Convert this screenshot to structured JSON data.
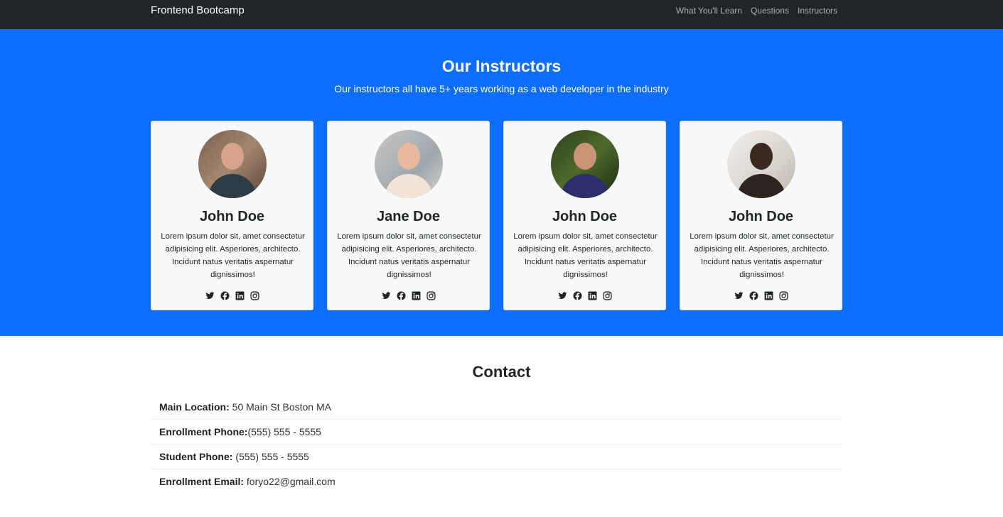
{
  "navbar": {
    "brand": "Frontend Bootcamp",
    "links": [
      "What You'll Learn",
      "Questions",
      "Instructors"
    ]
  },
  "instructors": {
    "title": "Our Instructors",
    "subtitle": "Our instructors all have 5+ years working as a web developer in the industry",
    "cards": [
      {
        "name": "John Doe",
        "text": "Lorem ipsum dolor sit, amet consectetur adipisicing elit. Asperiores, architecto. Incidunt natus veritatis aspernatur dignissimos!"
      },
      {
        "name": "Jane Doe",
        "text": "Lorem ipsum dolor sit, amet consectetur adipisicing elit. Asperiores, architecto. Incidunt natus veritatis aspernatur dignissimos!"
      },
      {
        "name": "John Doe",
        "text": "Lorem ipsum dolor sit, amet consectetur adipisicing elit. Asperiores, architecto. Incidunt natus veritatis aspernatur dignissimos!"
      },
      {
        "name": "John Doe",
        "text": "Lorem ipsum dolor sit, amet consectetur adipisicing elit. Asperiores, architecto. Incidunt natus veritatis aspernatur dignissimos!"
      }
    ],
    "social_icons": [
      "twitter-icon",
      "facebook-icon",
      "linkedin-icon",
      "instagram-icon"
    ]
  },
  "contact": {
    "title": "Contact",
    "items": [
      {
        "label": "Main Location:",
        "value": " 50 Main St Boston MA"
      },
      {
        "label": "Enrollment Phone:",
        "value": "(555) 555 - 5555"
      },
      {
        "label": "Student Phone:",
        "value": " (555) 555 - 5555"
      },
      {
        "label": "Enrollment Email:",
        "value": " foryo22@gmail.com"
      }
    ]
  },
  "colors": {
    "navbar_bg": "#212529",
    "primary_section_bg": "#0d6efd",
    "card_bg": "#f8f9fa"
  }
}
